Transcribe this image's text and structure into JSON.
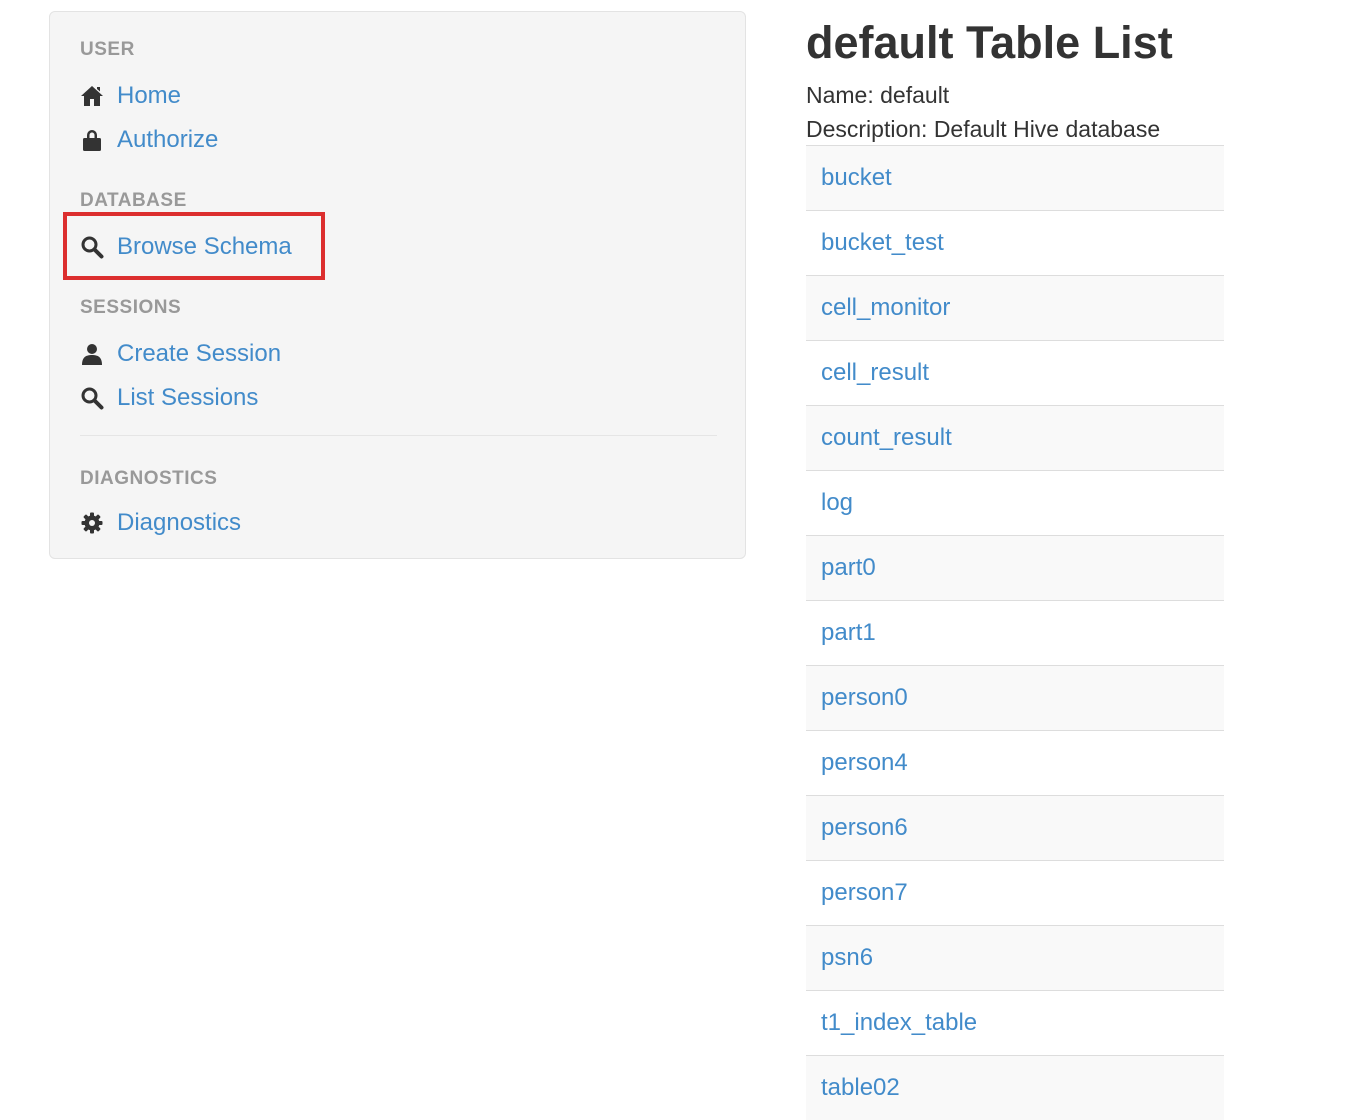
{
  "sidebar": {
    "user_header": "USER",
    "home_label": "Home",
    "authorize_label": "Authorize",
    "database_header": "DATABASE",
    "browse_schema_label": "Browse Schema",
    "sessions_header": "SESSIONS",
    "create_session_label": "Create Session",
    "list_sessions_label": "List Sessions",
    "diagnostics_header": "DIAGNOSTICS",
    "diagnostics_label": "Diagnostics",
    "icons": {
      "home": "home-icon",
      "authorize": "lock-icon",
      "browse_schema": "search-icon",
      "create_session": "user-icon",
      "list_sessions": "search-icon",
      "diagnostics": "gear-icon"
    },
    "highlight_color": "#dc2e2e"
  },
  "main": {
    "title": "default Table List",
    "name_line": "Name: default",
    "description_line": "Description: Default Hive database",
    "tables": [
      "bucket",
      "bucket_test",
      "cell_monitor",
      "cell_result",
      "count_result",
      "log",
      "part0",
      "part1",
      "person0",
      "person4",
      "person6",
      "person7",
      "psn6",
      "t1_index_table",
      "table02"
    ]
  },
  "colors": {
    "link": "#428bca",
    "header": "#999999",
    "text": "#333333"
  }
}
